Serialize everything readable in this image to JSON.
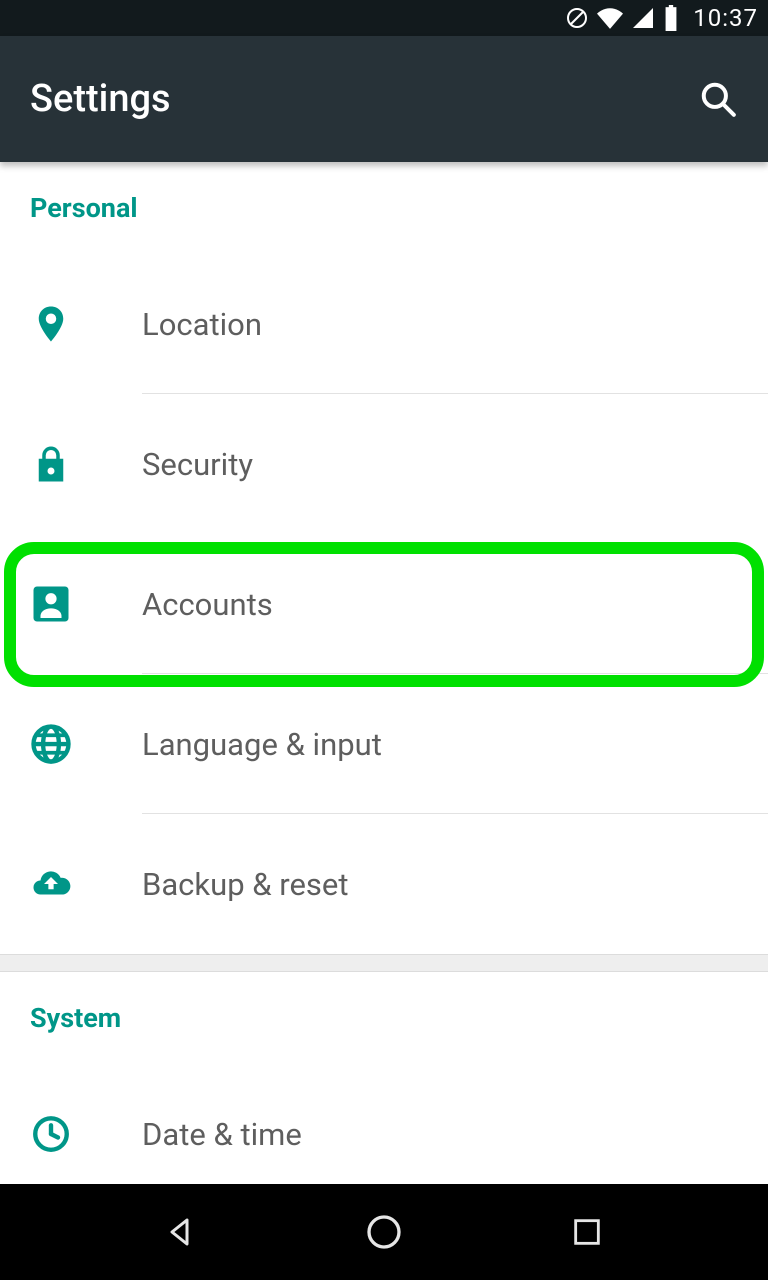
{
  "status": {
    "time": "10:37"
  },
  "appbar": {
    "title": "Settings"
  },
  "sections": {
    "personal": {
      "header": "Personal",
      "items": [
        {
          "label": "Location"
        },
        {
          "label": "Security"
        },
        {
          "label": "Accounts"
        },
        {
          "label": "Language & input"
        },
        {
          "label": "Backup & reset"
        }
      ]
    },
    "system": {
      "header": "System",
      "items": [
        {
          "label": "Date & time"
        }
      ]
    }
  },
  "colors": {
    "accent": "#009688",
    "highlight": "#00e000"
  }
}
